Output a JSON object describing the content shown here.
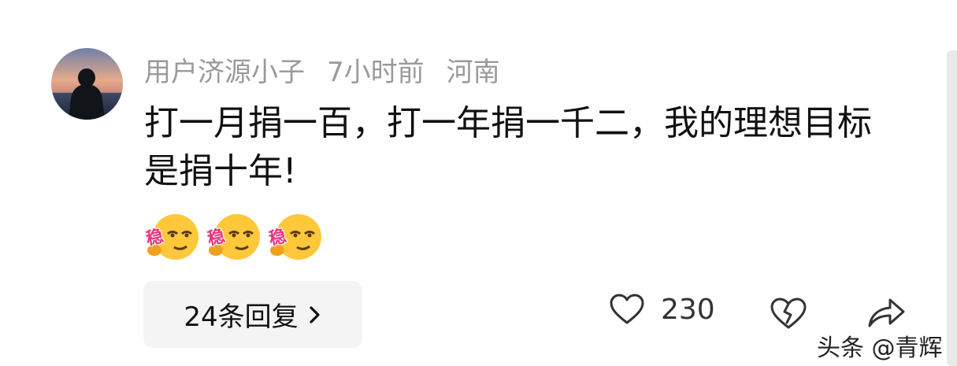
{
  "comment": {
    "username": "用户济源小子",
    "time": "7小时前",
    "location": "河南",
    "text": "打一月捐一百，打一年捐一千二，我的理想目标是捐十年!",
    "emojis": [
      {
        "label": "稳",
        "icon": "wen-emoji-icon"
      },
      {
        "label": "稳",
        "icon": "wen-emoji-icon"
      },
      {
        "label": "稳",
        "icon": "wen-emoji-icon"
      }
    ]
  },
  "actions": {
    "replies_label": "24条回复",
    "like_count": "230",
    "like_icon": "heart-outline-icon",
    "dislike_icon": "broken-heart-icon",
    "share_icon": "share-arrow-icon"
  },
  "watermark": "头条 @青辉",
  "colors": {
    "meta_text": "#9a9a9a",
    "body_text": "#111111",
    "reply_bg": "#f4f4f4",
    "icon_stroke": "#333333",
    "emoji_yellow": "#ffc83a",
    "emoji_label": "#e8357d"
  }
}
